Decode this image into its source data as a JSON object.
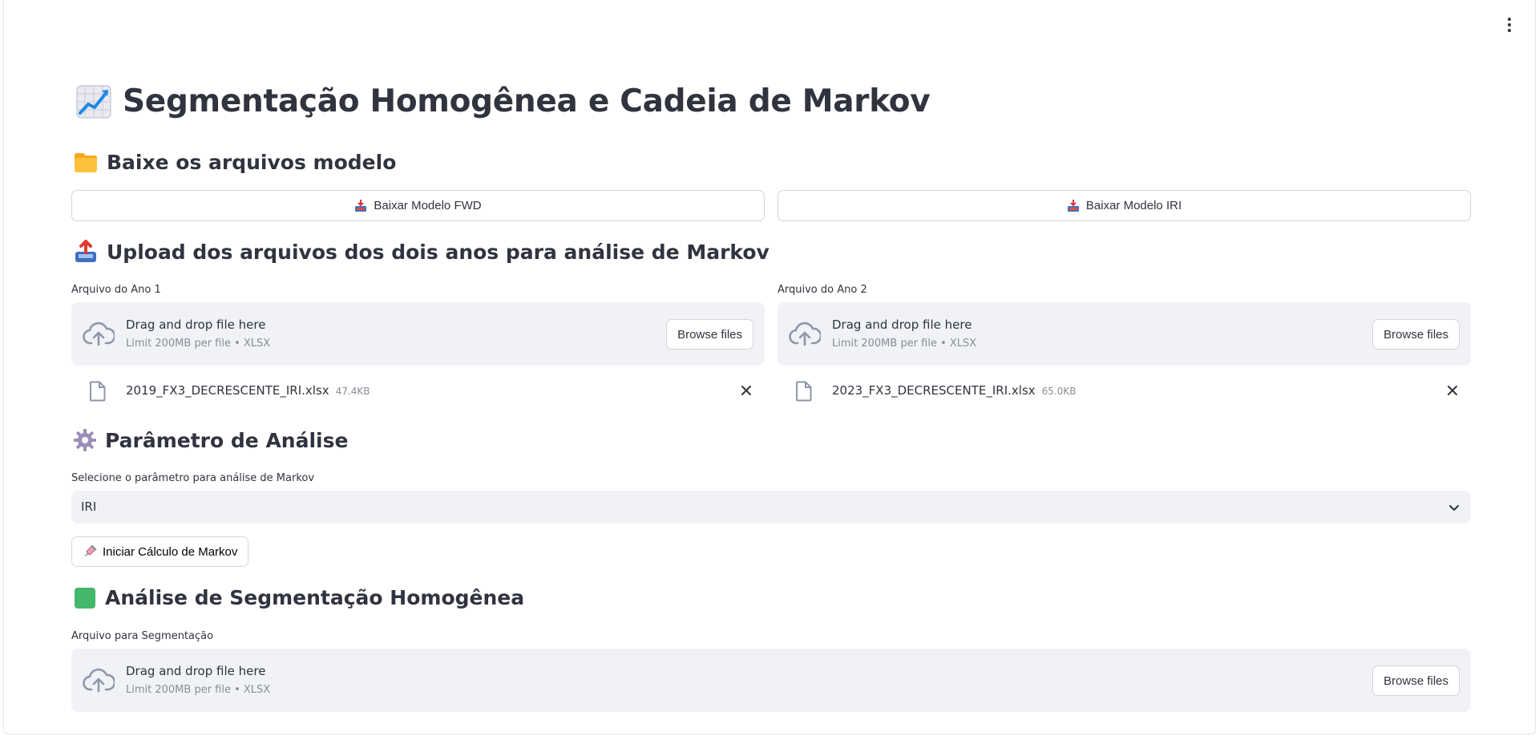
{
  "page": {
    "title": "Segmentação Homogênea e Cadeia de Markov",
    "title_icon": "chart-increasing-icon"
  },
  "menu": {
    "icon": "kebab-menu-icon"
  },
  "templates": {
    "heading": "Baixe os arquivos modelo",
    "heading_icon": "folder-icon",
    "fwd_button": "Baixar Modelo FWD",
    "iri_button": "Baixar Modelo IRI",
    "button_icon": "inbox-tray-icon"
  },
  "upload": {
    "heading": "Upload dos arquivos dos dois anos para análise de Markov",
    "heading_icon": "outbox-tray-icon",
    "year1": {
      "label": "Arquivo do Ano 1",
      "drop_text": "Drag and drop file here",
      "limit_text": "Limit 200MB per file • XLSX",
      "browse_label": "Browse files",
      "file_name": "2019_FX3_DECRESCENTE_IRI.xlsx",
      "file_size": "47.4KB"
    },
    "year2": {
      "label": "Arquivo do Ano 2",
      "drop_text": "Drag and drop file here",
      "limit_text": "Limit 200MB per file • XLSX",
      "browse_label": "Browse files",
      "file_name": "2023_FX3_DECRESCENTE_IRI.xlsx",
      "file_size": "65.0KB"
    }
  },
  "parameter": {
    "heading": "Parâmetro de Análise",
    "heading_icon": "gear-icon",
    "select_label": "Selecione o parâmetro para análise de Markov",
    "selected_value": "IRI",
    "run_button": "Iniciar Cálculo de Markov",
    "run_icon": "syringe-icon"
  },
  "segmentation": {
    "heading": "Análise de Segmentação Homogênea",
    "heading_icon": "green-square-icon",
    "label": "Arquivo para Segmentação",
    "drop_text": "Drag and drop file here",
    "limit_text": "Limit 200MB per file • XLSX",
    "browse_label": "Browse files"
  },
  "colors": {
    "text": "#31333f",
    "muted": "#8a8d98",
    "dropzone_bg": "#f0f2f6",
    "border": "#d6d6d9"
  }
}
